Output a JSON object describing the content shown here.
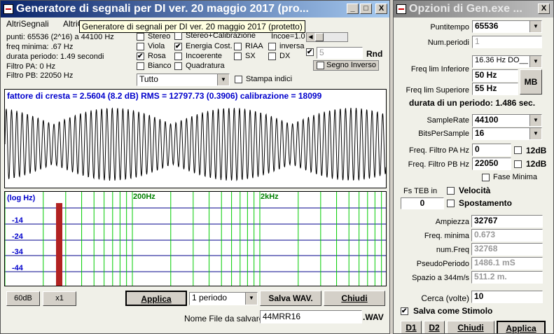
{
  "main": {
    "title": "Generatore di segnali per DI  ver. 20 maggio 2017 (pro...",
    "minimize": "_",
    "maximize": "□",
    "close": "X",
    "menu": [
      "AltriSegnali",
      "AltriC"
    ],
    "tooltip": "Generatore di segnali per DI  ver. 20 maggio 2017 (protetto)",
    "info": {
      "points": "punti: 65536 (2^16) a 44100 Hz",
      "freq_min": "freq minima: .67 Hz",
      "period": "durata periodo: 1.49 secondi",
      "filter_pa": "Filtro PA: 0 Hz",
      "filter_pb": "Filtro PB: 22050 Hz"
    },
    "options": {
      "stereo": "Stereo",
      "stereo_cal": "Stereo+Calibrazione",
      "incoe": "Incoe=1.0",
      "viola": "Viola",
      "energia": "Energia Cost.",
      "riaa": "RIAA",
      "inversa": "inversa",
      "rosa": "Rosa",
      "incoerente": "Incoerente",
      "sx": "SX",
      "dx": "DX",
      "bianco": "Bianco",
      "quadratura": "Quadratura",
      "rnd_value": "5",
      "rnd": "Rnd",
      "segno_inverso": "Segno Inverso",
      "tutto": "Tutto",
      "stampa_indici": "Stampa indici"
    },
    "wave_header": "fattore di cresta = 2.5604 (8.2 dB) RMS = 12797.73 (0.3906)  calibrazione = 18099",
    "spectrum": {
      "axis_label": "(log Hz)",
      "marker_200": "200Hz",
      "marker_2k": "2kHz",
      "db_labels": [
        "-14",
        "-24",
        "-34",
        "-44"
      ]
    },
    "buttons": {
      "db60": "60dB",
      "x1": "x1",
      "applica": "Applica",
      "periodo": "1 periodo",
      "salva": "Salva WAV.",
      "chiudi": "Chiudi"
    },
    "filename_label": "Nome File da salvare",
    "filename": "44MRR16",
    "ext": ".WAV"
  },
  "opts": {
    "title": "Opzioni di Gen.exe ...",
    "close": "X",
    "puntitempo_label": "Puntitempo",
    "puntitempo": "65536",
    "numperiodi_label": "Num.periodi",
    "numperiodi": "1",
    "freqlim_inf_label": "Freq lim Inferiore",
    "freqlim_combo": "16.36 Hz DO__",
    "freq_inf": "50 Hz",
    "freqlim_sup_label": "Freq lim Superiore",
    "freq_sup": "55 Hz",
    "mb": "MB",
    "durata": "durata di un periodo: 1.486 sec.",
    "samplerate_label": "SampleRate",
    "samplerate": "44100",
    "bits_label": "BitsPerSample",
    "bits": "16",
    "filtro_pa_label": "Freq. Filtro PA Hz",
    "filtro_pa": "0",
    "db12": "12dB",
    "filtro_pb_label": "Freq. Filtro PB Hz",
    "filtro_pb": "22050",
    "fase_minima": "Fase Minima",
    "fsteb": "Fs TEB  in",
    "velocita": "Velocità",
    "fsteb_value": "0",
    "spostamento": "Spostamento",
    "ampiezza_label": "Ampiezza",
    "ampiezza": "32767",
    "freqmin_label": "Freq. minima",
    "freqmin": "0.673",
    "numfreq_label": "num.Freq",
    "numfreq": "32768",
    "pseudo_label": "PseudoPeriodo",
    "pseudo": "1486.1 mS",
    "spazio_label": "Spazio a 344m/s",
    "spazio": "511.2 m.",
    "cerca_label": "Cerca (volte)",
    "cerca": "10",
    "salva_stimolo": "Salva come Stimolo",
    "d1": "D1",
    "d2": "D2",
    "chiudi": "Chiudi",
    "applica": "Applica"
  },
  "colors": {
    "wave": "#000000",
    "spectrum_grid_h": "#00008b",
    "spectrum_grid_v": "#00cc00",
    "spectrum_bar": "#b22222",
    "header_text": "#0000cc"
  }
}
